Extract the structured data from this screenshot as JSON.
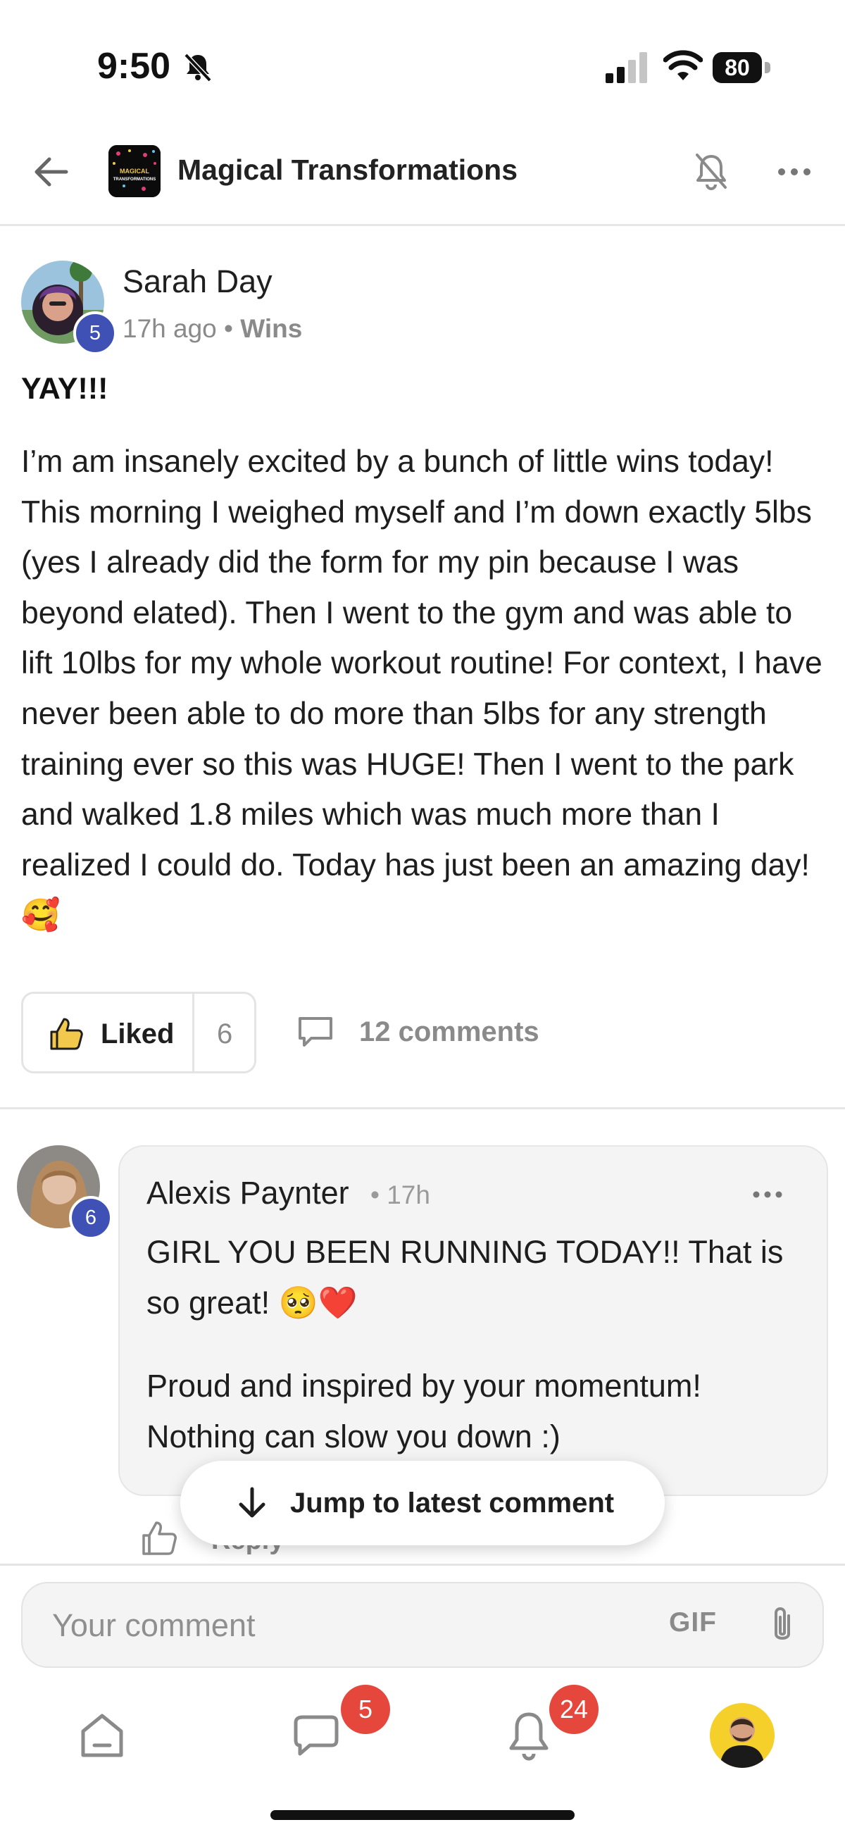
{
  "status_bar": {
    "time": "9:50",
    "battery": "80"
  },
  "header": {
    "title": "Magical Transformations",
    "logo_text": "MAGICAL TRANSFORMATIONS"
  },
  "post": {
    "author": "Sarah Day",
    "author_level": "5",
    "time_ago": "17h ago",
    "separator": "•",
    "category": "Wins",
    "title": "YAY!!!",
    "body": "I’m am insanely excited by a bunch of little wins today! This morning I weighed myself and I’m down exactly 5lbs (yes I already did the form for my pin because I was beyond elated). Then I went to the gym and was able to lift 10lbs for my whole workout routine! For context, I have never been able to do more than 5lbs for any strength training ever so this was HUGE! Then I went to the park and walked 1.8 miles which was much more than I realized I could do. Today has just been an amazing day! 🥰",
    "like_label": "Liked",
    "like_count": "6",
    "comments_label": "12 comments"
  },
  "comment": {
    "author": "Alexis Paynter",
    "author_level": "6",
    "time": "• 17h",
    "paragraphs": [
      "GIRL YOU BEEN RUNNING TODAY!! That is so great! 🥺❤️",
      "Proud and inspired by your momentum! Nothing can slow you down :)"
    ],
    "reply_label": "Reply"
  },
  "jump_button": {
    "label": "Jump to latest comment"
  },
  "composer": {
    "placeholder": "Your comment",
    "gif_label": "GIF"
  },
  "bottom_nav": {
    "chat_badge": "5",
    "notifications_badge": "24"
  },
  "colors": {
    "accent": "#3f51b5",
    "badge": "#e5473c",
    "bubble": "#f4f4f4"
  }
}
